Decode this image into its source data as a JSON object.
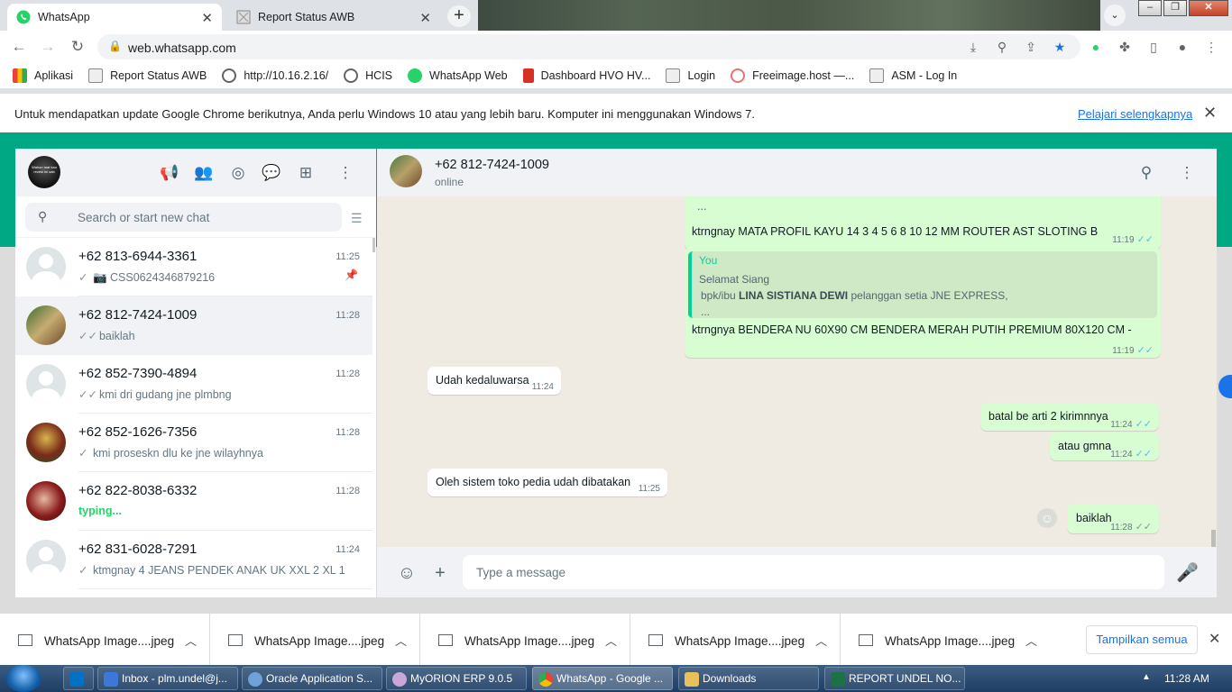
{
  "browser": {
    "tabs": [
      {
        "label": "WhatsApp",
        "active": true
      },
      {
        "label": "Report Status AWB",
        "active": false
      }
    ],
    "url": "web.whatsapp.com",
    "bookmarks": [
      "Aplikasi",
      "Report Status AWB",
      "http://10.16.2.16/",
      "HCIS",
      "WhatsApp Web",
      "Dashboard HVO HV...",
      "Login",
      "Freeimage.host —...",
      "ASM - Log In"
    ],
    "infobar": {
      "message": "Untuk mendapatkan update Google Chrome berikutnya, Anda perlu Windows 10 atau yang lebih baru. Komputer ini menggunakan Windows 7.",
      "link": "Pelajari selengkapnya"
    }
  },
  "sidebar": {
    "profile_text": "Wahon mat kau rezeki ini sab",
    "search_placeholder": "Search or start new chat",
    "chats": [
      {
        "name": "+62 813-6944-3361",
        "time": "11:25",
        "preview": "CSS0624346879216",
        "tick": "✓",
        "photo": true,
        "pinned": true
      },
      {
        "name": "+62 812-7424-1009",
        "time": "11:28",
        "preview": "baiklah",
        "tick": "✓✓",
        "selected": true
      },
      {
        "name": "+62 852-7390-4894",
        "time": "11:28",
        "preview": "kmi dri gudang jne plmbng",
        "tick": "✓✓"
      },
      {
        "name": "+62 852-1626-7356",
        "time": "11:28",
        "preview": "kmi proseskn dlu ke jne wilayhnya",
        "tick": "✓"
      },
      {
        "name": "+62 822-8038-6332",
        "time": "11:28",
        "preview": "typing...",
        "typing": true
      },
      {
        "name": "+62 831-6028-7291",
        "time": "11:24",
        "preview": "ktmgnay 4 JEANS PENDEK ANAK UK XXL 2 XL 1",
        "tick": "✓"
      }
    ]
  },
  "conversation": {
    "contact_name": "+62 812-7424-1009",
    "status": "online",
    "messages": {
      "m1_tail": "...",
      "m1_text": "ktrngnay MATA PROFIL KAYU 14 3 4 5 6 8 10 12 MM ROUTER AST SLOTING B",
      "m1_time": "11:19",
      "m2_quote_author": "You",
      "m2_quote_line1": "Selamat Siang",
      "m2_quote_line2_pre": "bpk/ibu ",
      "m2_quote_line2_bold": "LINA SISTIANA DEWI",
      "m2_quote_line2_post": " pelanggan setia JNE EXPRESS,",
      "m2_quote_line3": "...",
      "m2_text": "ktrngnya BENDERA NU 60X90 CM BENDERA MERAH PUTIH PREMIUM 80X120 CM -",
      "m2_time": "11:19",
      "m3_text": "Udah kedaluwarsa",
      "m3_time": "11:24",
      "m4_text": "batal be arti 2 kirimnnya",
      "m4_time": "11:24",
      "m5_text": "atau gmna",
      "m5_time": "11:24",
      "m6_text": "Oleh sistem toko pedia udah dibatakan",
      "m6_time": "11:25",
      "m7_text": "baiklah",
      "m7_time": "11:28"
    },
    "input_placeholder": "Type a message"
  },
  "downloads": {
    "items": [
      "WhatsApp Image....jpeg",
      "WhatsApp Image....jpeg",
      "WhatsApp Image....jpeg",
      "WhatsApp Image....jpeg",
      "WhatsApp Image....jpeg"
    ],
    "show_all": "Tampilkan semua"
  },
  "taskbar": {
    "items": [
      "Inbox - plm.undel@j...",
      "Oracle Application S...",
      "MyORION ERP 9.0.5",
      "WhatsApp - Google ...",
      "Downloads",
      "REPORT UNDEL NO..."
    ],
    "clock": "11:28 AM"
  },
  "colors": {
    "wa_green": "#00a884",
    "outgoing": "#d9fdd3",
    "read_tick": "#53bdeb",
    "typing": "#25d366"
  }
}
